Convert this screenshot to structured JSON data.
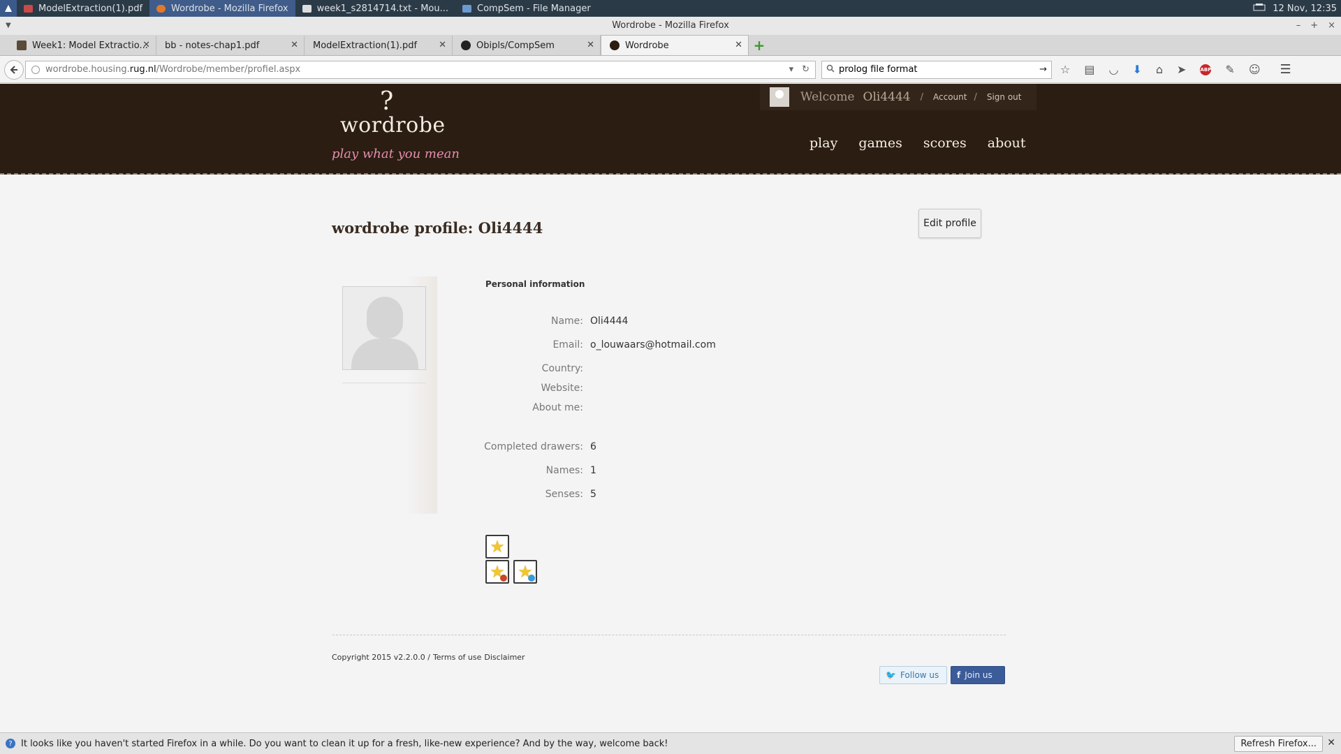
{
  "taskbar": {
    "tasks": [
      {
        "label": "ModelExtraction(1).pdf",
        "color": "#c84a4a"
      },
      {
        "label": "Wordrobe - Mozilla Firefox",
        "color": "#e07a2a"
      },
      {
        "label": "week1_s2814714.txt - Mou...",
        "color": "#dddddd"
      },
      {
        "label": "CompSem - File Manager",
        "color": "#6a9ad0"
      }
    ],
    "clock": "12 Nov, 12:35"
  },
  "window": {
    "title": "Wordrobe - Mozilla Firefox"
  },
  "tabs": [
    {
      "label": "Week1: Model Extractio...",
      "icon_color": "#5a4a3a"
    },
    {
      "label": "bb - notes-chap1.pdf",
      "icon_color": "#d8d8d8"
    },
    {
      "label": "ModelExtraction(1).pdf",
      "icon_color": "#d8d8d8"
    },
    {
      "label": "Obipls/CompSem",
      "icon_color": "#222222"
    },
    {
      "label": "Wordrobe",
      "icon_color": "#2b1d12"
    }
  ],
  "toolbar": {
    "url_prefix": "wordrobe.housing.",
    "url_domain": "rug.nl",
    "url_path": "/Wordrobe/member/profiel.aspx",
    "search_value": "prolog file format"
  },
  "site": {
    "logo_mark": "?",
    "logo_text": "wordrobe",
    "tagline": "play what you mean",
    "welcome": "Welcome",
    "username": "Oli4444",
    "separator": "/",
    "account_link": "Account",
    "signout_link": "Sign out",
    "nav": [
      "play",
      "games",
      "scores",
      "about"
    ]
  },
  "profile": {
    "title": "wordrobe profile: Oli4444",
    "edit_button": "Edit profile",
    "section_title": "Personal information",
    "fields": [
      {
        "label": "Name:",
        "value": "Oli4444"
      },
      {
        "label": "Email:",
        "value": "o_louwaars@hotmail.com"
      },
      {
        "label": "Country:",
        "value": ""
      },
      {
        "label": "Website:",
        "value": ""
      },
      {
        "label": "About me:",
        "value": ""
      },
      {
        "label": "Completed drawers:",
        "value": "6"
      },
      {
        "label": "Names:",
        "value": "1"
      },
      {
        "label": "Senses:",
        "value": "5"
      }
    ]
  },
  "footer": {
    "copyright": "Copyright 2015 v2.2.0.0 /",
    "terms": "Terms of use",
    "disclaimer": "Disclaimer",
    "follow": "Follow us",
    "join": "Join us"
  },
  "notification": {
    "message": "It looks like you haven't started Firefox in a while. Do you want to clean it up for a fresh, like-new experience? And by the way, welcome back!",
    "button": "Refresh Firefox..."
  }
}
